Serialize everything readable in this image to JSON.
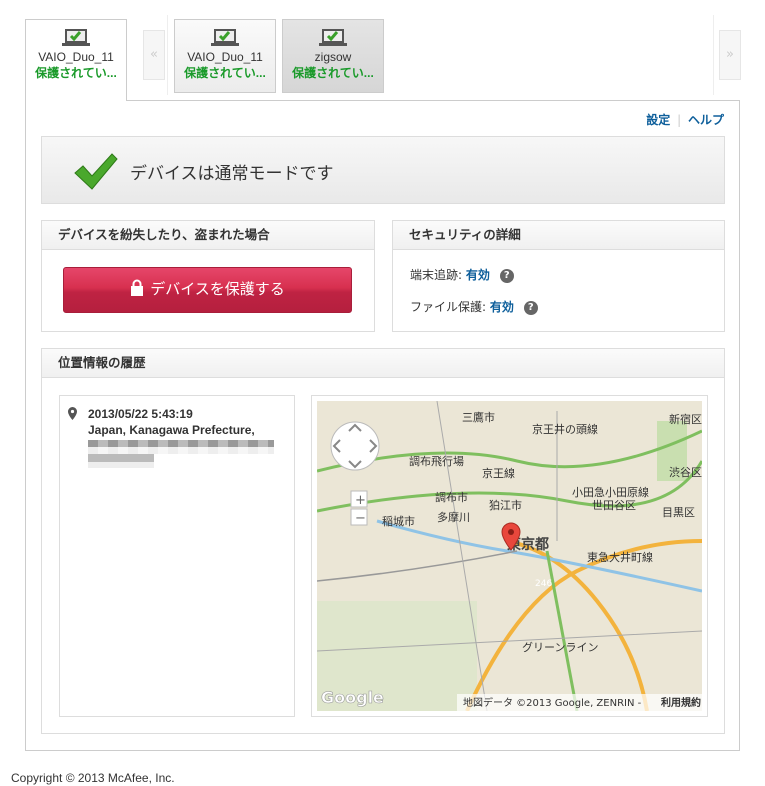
{
  "tabs": [
    {
      "name": "VAIO_Duo_11",
      "status": "保護されてい...",
      "active": true
    },
    {
      "name": "VAIO_Duo_11",
      "status": "保護されてい..."
    },
    {
      "name": "zigsow",
      "status": "保護されてい...",
      "selected": true
    }
  ],
  "nav": {
    "prev": "«",
    "next": "»"
  },
  "links": {
    "settings": "設定",
    "help": "ヘルプ"
  },
  "status_banner": {
    "text": "デバイスは通常モードです",
    "icon": "check-icon"
  },
  "lost_panel": {
    "title": "デバイスを紛失したり、盗まれた場合",
    "button": "デバイスを保護する"
  },
  "security_panel": {
    "title": "セキュリティの詳細",
    "rows": [
      {
        "label": "端末追跡:",
        "value": "有効"
      },
      {
        "label": "ファイル保護:",
        "value": "有効"
      }
    ],
    "help_glyph": "?"
  },
  "location_panel": {
    "title": "位置情報の履歴",
    "entry": {
      "time": "2013/05/22 5:43:19",
      "place": "Japan, Kanagawa Prefecture,"
    }
  },
  "map": {
    "labels": [
      "三鷹市",
      "京王井の頭線",
      "新宿区",
      "調布飛行場",
      "京王線",
      "小田急小田原線",
      "渋谷区",
      "調布市",
      "狛江市",
      "世田谷区",
      "稲城市",
      "多摩川",
      "目黒区",
      "東京都",
      "東急大井町線",
      "246",
      "グリーンライン"
    ],
    "attribution": "地図データ ©2013 Google, ZENRIN -",
    "terms": "利用規約",
    "logo": "Google",
    "zoom_in": "+",
    "zoom_out": "−"
  },
  "footer": "Copyright © 2013 McAfee, Inc.",
  "colors": {
    "accent_green": "#1a9a2a",
    "button_red": "#d7304f",
    "link": "#0e5f9b"
  }
}
